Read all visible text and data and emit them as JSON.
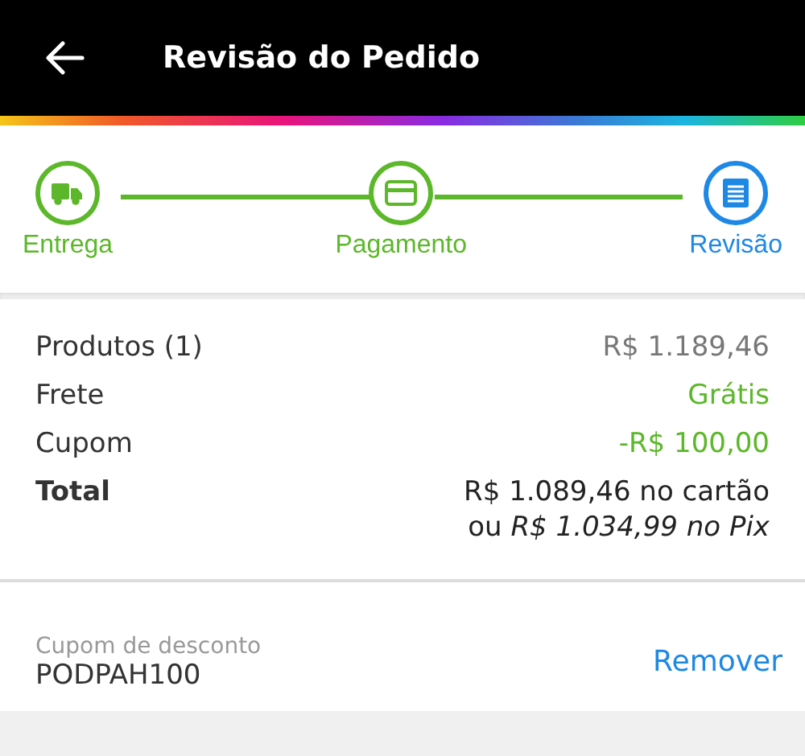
{
  "header": {
    "title": "Revisão do Pedido"
  },
  "steps": [
    {
      "label": "Entrega",
      "kind": "truck",
      "selected": false
    },
    {
      "label": "Pagamento",
      "kind": "card",
      "selected": false
    },
    {
      "label": "Revisão",
      "kind": "receipt",
      "selected": true
    }
  ],
  "summary": [
    {
      "label": "Produtos (1)",
      "value": "R$ 1.189,46",
      "kind": "neutral"
    },
    {
      "label": "Frete",
      "value": "Grátis",
      "kind": "positive"
    },
    {
      "label": "Cupom",
      "value": "-R$ 100,00",
      "kind": "positive"
    }
  ],
  "total": {
    "label": "Total",
    "card_price": "R$ 1.089,46 no cartão",
    "pix_price": "ou *R$ 1.034,99 no Pix*"
  },
  "coupon": {
    "placeholder": "Cupom de desconto",
    "value": "PODPAH100",
    "action": "Remover"
  }
}
